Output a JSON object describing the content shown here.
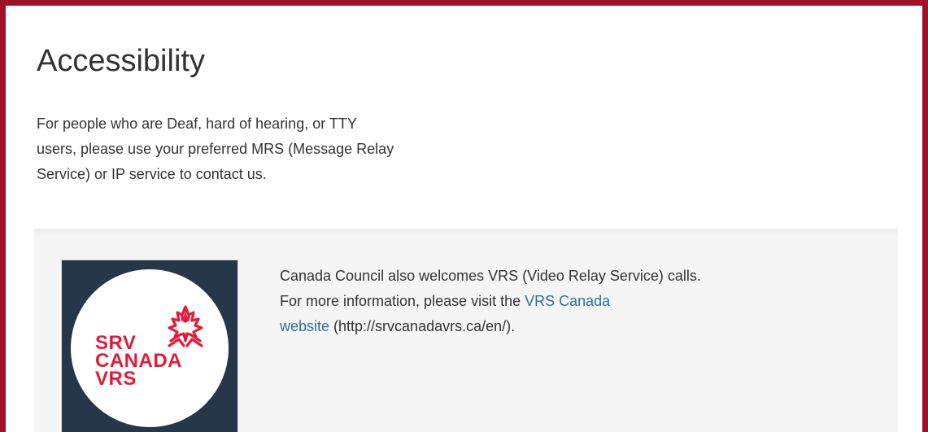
{
  "accent_border_color": "#a0102a",
  "link_color": "#2d6ea3",
  "header": {
    "title": "Accessibility"
  },
  "intro": {
    "lines": [
      "For people who are Deaf, hard of hearing, or TTY",
      "users, please use your preferred MRS (Message Relay",
      "Service) or IP service to contact us."
    ]
  },
  "callout": {
    "logo": {
      "icon": "maple-leaf-hands-icon",
      "text_lines": [
        "SRV",
        "CANADA",
        "VRS"
      ],
      "brand_color": "#e31b3b",
      "background_color": "#26374a"
    },
    "line1": "Canada Council also welcomes VRS (Video Relay Service) calls.",
    "line2_prefix": "For more information, please visit the ",
    "link_part1": "VRS Canada",
    "link_part2": "website",
    "line3_suffix": " (http://srvcanadavrs.ca/en/)."
  }
}
